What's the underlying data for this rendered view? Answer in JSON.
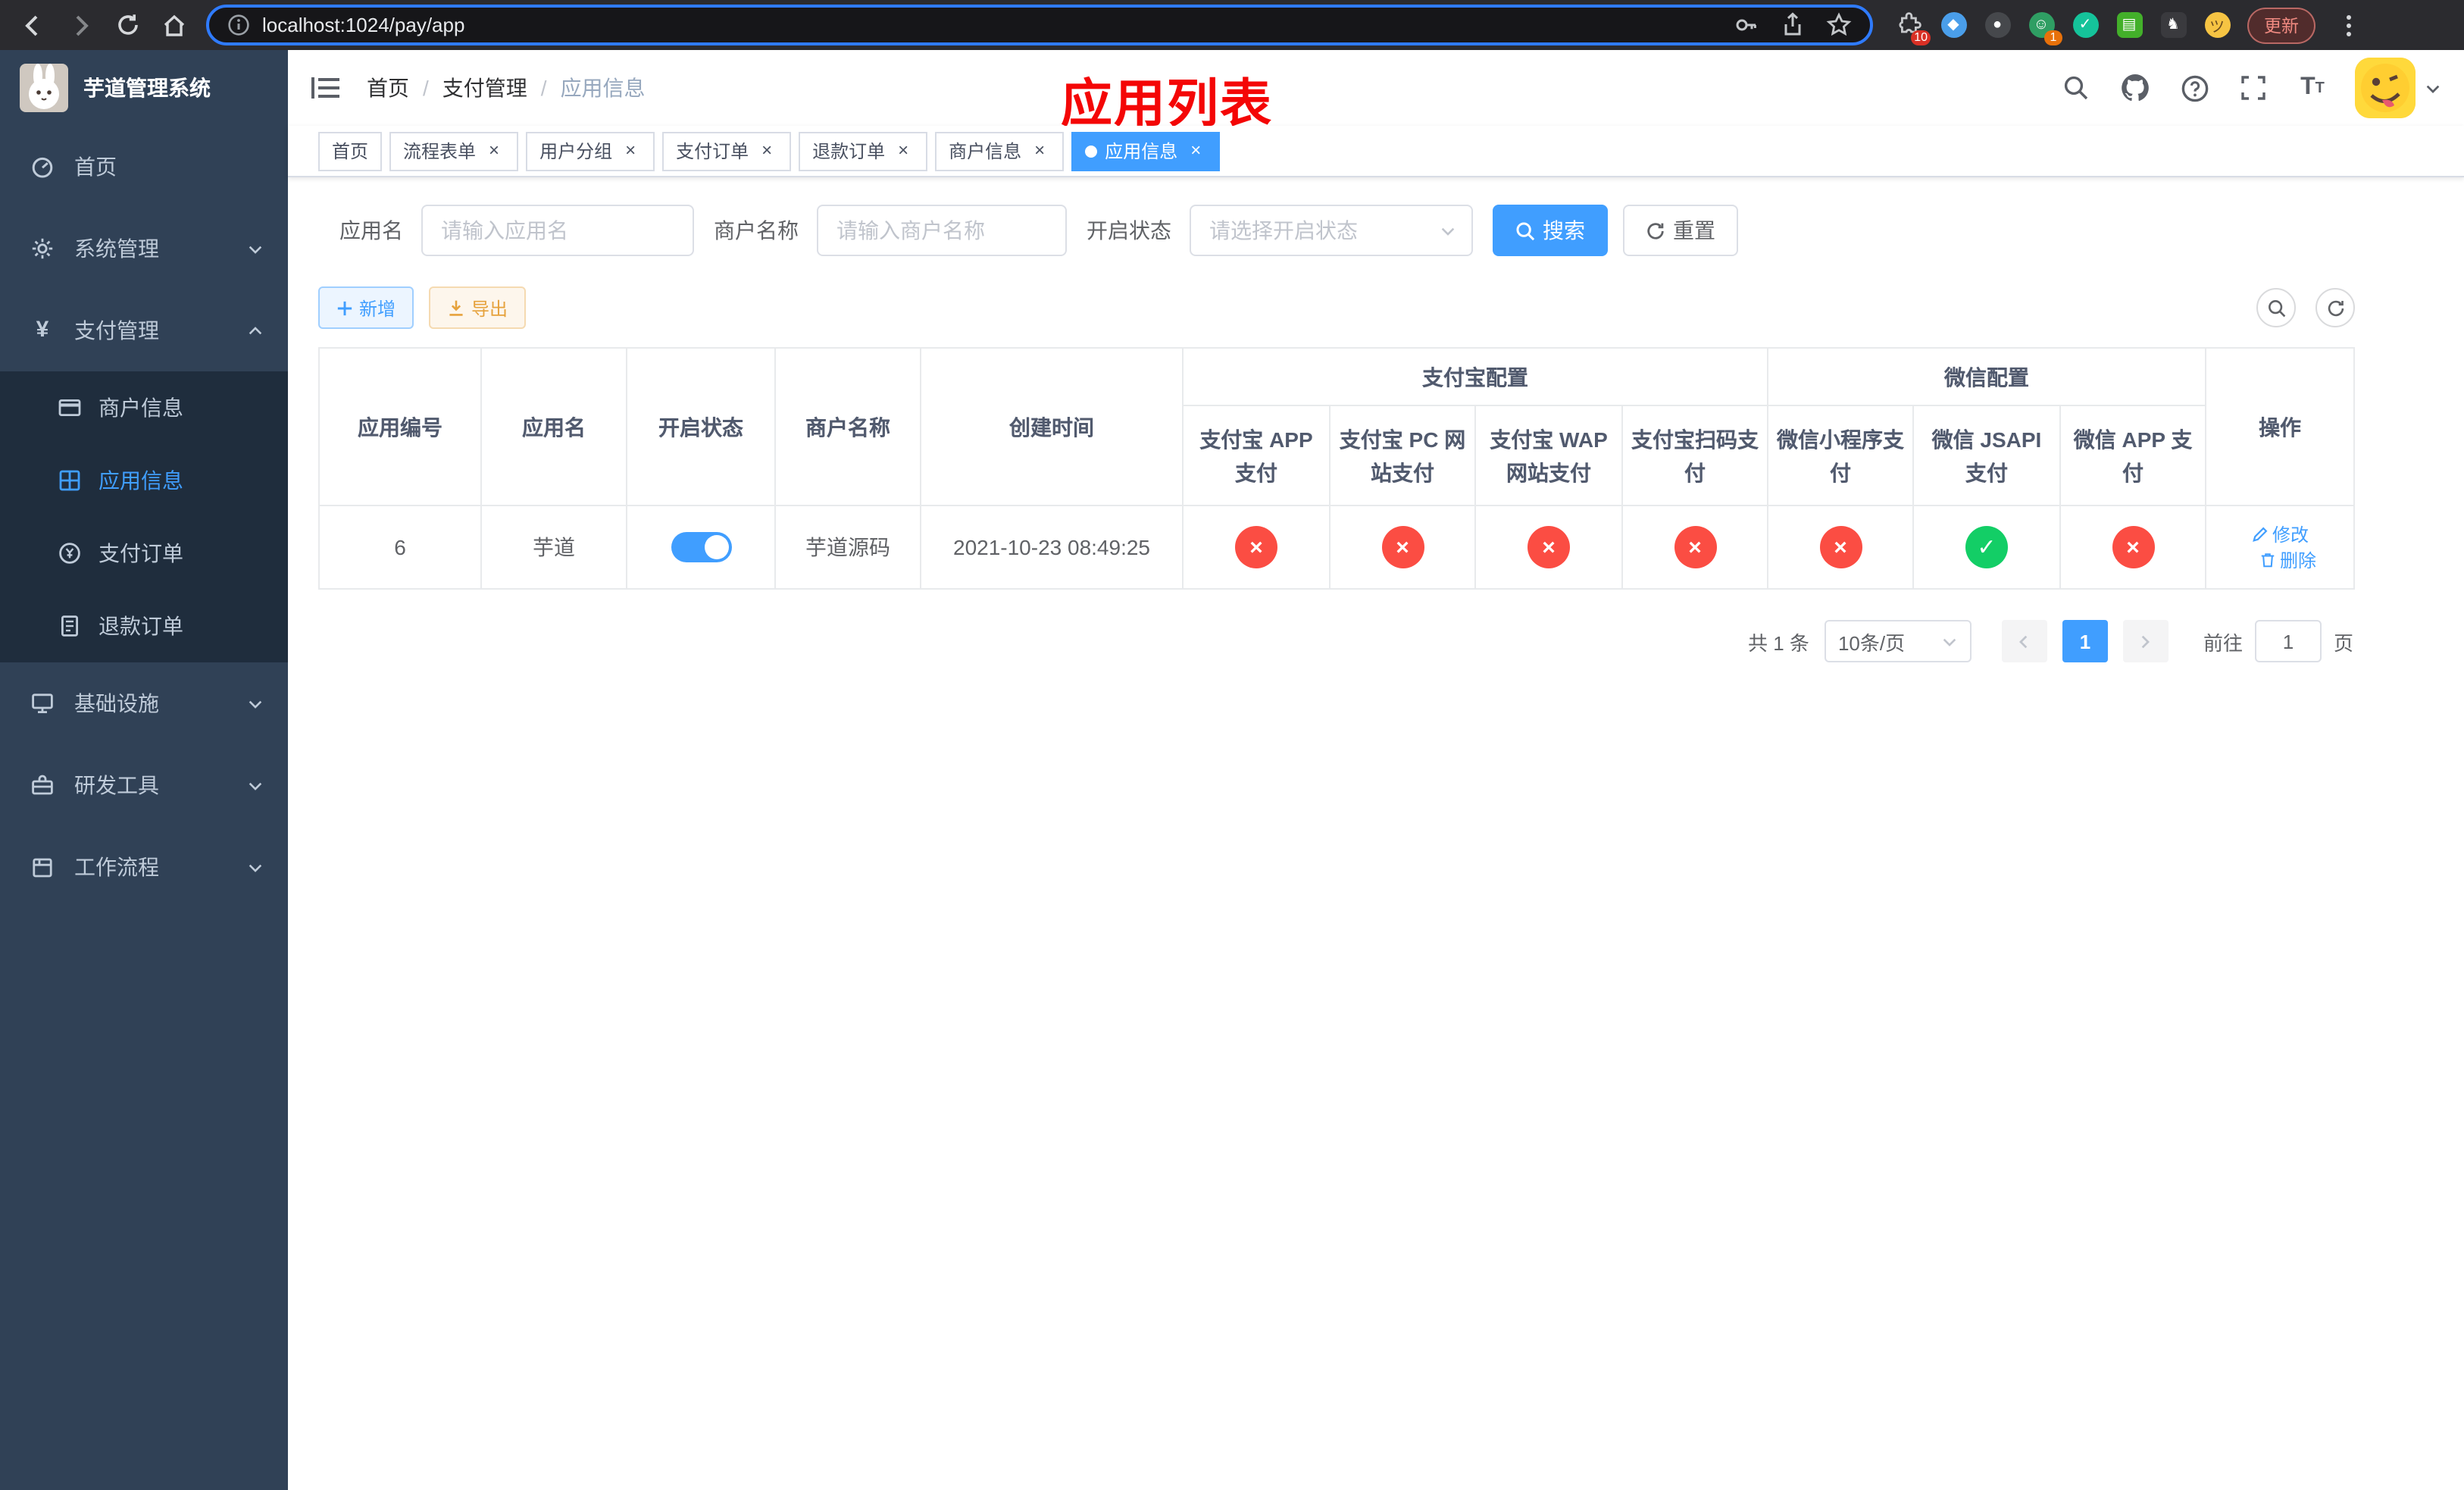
{
  "browser": {
    "url": "localhost:1024/pay/app",
    "update_label": "更新",
    "extensions_badge": "10",
    "profile_badge": "1"
  },
  "sidebar": {
    "title": "芋道管理系统",
    "items": [
      {
        "label": "首页"
      },
      {
        "label": "系统管理"
      },
      {
        "label": "支付管理"
      },
      {
        "label": "商户信息"
      },
      {
        "label": "应用信息"
      },
      {
        "label": "支付订单"
      },
      {
        "label": "退款订单"
      },
      {
        "label": "基础设施"
      },
      {
        "label": "研发工具"
      },
      {
        "label": "工作流程"
      }
    ]
  },
  "navbar": {
    "breadcrumb": [
      "首页",
      "支付管理",
      "应用信息"
    ],
    "annotation": "应用列表"
  },
  "tabs": [
    {
      "label": "首页"
    },
    {
      "label": "流程表单"
    },
    {
      "label": "用户分组"
    },
    {
      "label": "支付订单"
    },
    {
      "label": "退款订单"
    },
    {
      "label": "商户信息"
    },
    {
      "label": "应用信息"
    }
  ],
  "filters": {
    "app_name_label": "应用名",
    "app_name_placeholder": "请输入应用名",
    "merchant_label": "商户名称",
    "merchant_placeholder": "请输入商户名称",
    "status_label": "开启状态",
    "status_placeholder": "请选择开启状态",
    "search_label": "搜索",
    "reset_label": "重置"
  },
  "toolbar": {
    "add_label": "新增",
    "export_label": "导出"
  },
  "table": {
    "groups": {
      "alipay": "支付宝配置",
      "wechat": "微信配置"
    },
    "columns": {
      "id": "应用编号",
      "name": "应用名",
      "status": "开启状态",
      "merchant": "商户名称",
      "created": "创建时间",
      "alipay_app": "支付宝 APP 支付",
      "alipay_pc": "支付宝 PC 网站支付",
      "alipay_wap": "支付宝 WAP 网站支付",
      "alipay_qr": "支付宝扫码支付",
      "wechat_mini": "微信小程序支付",
      "wechat_jsapi": "微信 JSAPI 支付",
      "wechat_app": "微信 APP 支付",
      "actions": "操作"
    },
    "row": {
      "id": "6",
      "name": "芋道",
      "status_on": true,
      "merchant": "芋道源码",
      "created": "2021-10-23 08:49:25",
      "pay_flags": [
        false,
        false,
        false,
        false,
        false,
        true,
        false
      ],
      "edit_label": "修改",
      "delete_label": "删除"
    }
  },
  "pagination": {
    "total": "共 1 条",
    "page_size": "10条/页",
    "page": "1",
    "goto": "前往",
    "goto_value": "1",
    "unit": "页"
  },
  "colors": {
    "accent": "#409EFF",
    "danger": "#fb4d43",
    "success": "#13ce66",
    "sidebar_bg": "#304156",
    "annotation_red": "#f40606"
  }
}
